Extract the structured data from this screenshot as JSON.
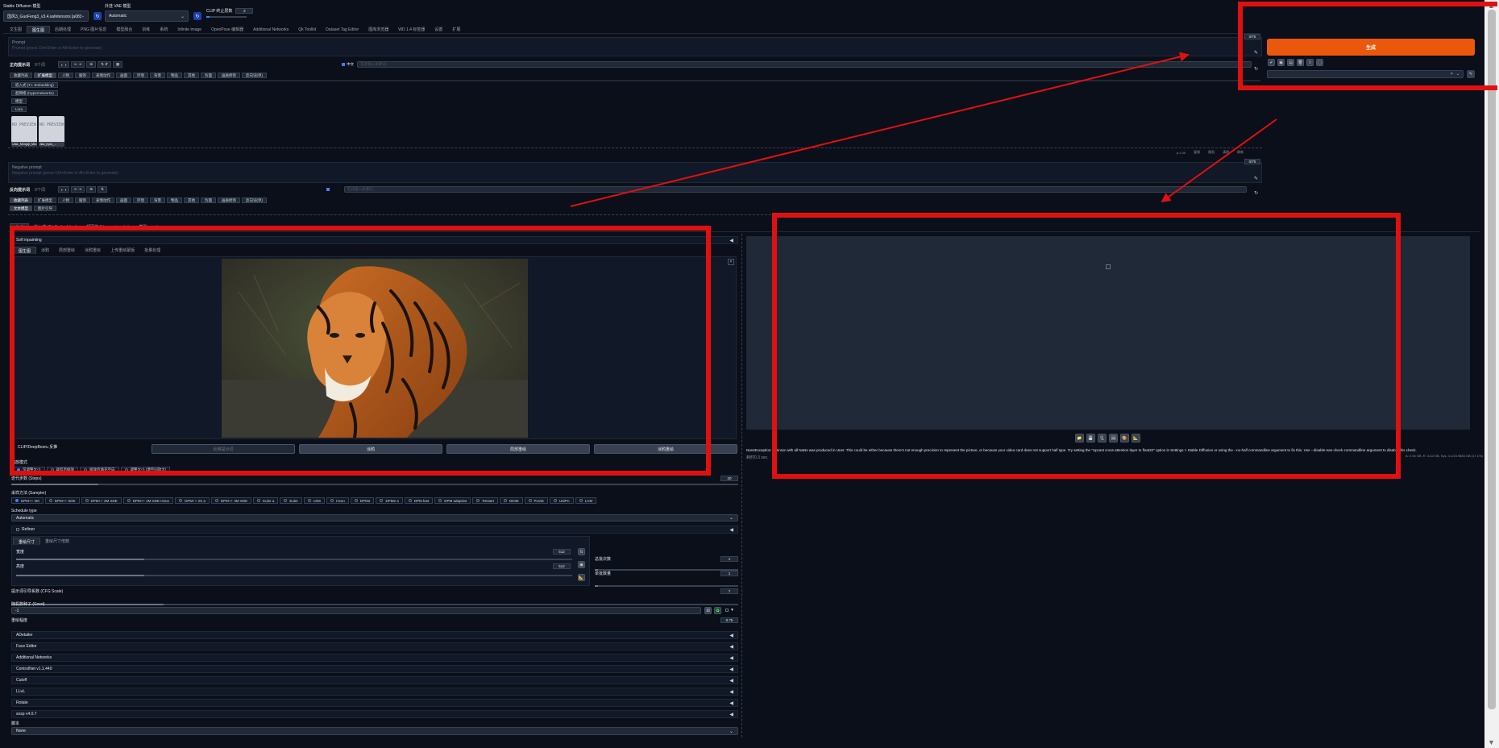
{
  "top": {
    "checkpoint_label": "Stable Diffusion 模型",
    "checkpoint_value": "国风3_GuoFeng3_v3.4.safetensors [a083e8...",
    "vae_label": "外挂 VAE 模型",
    "vae_value": "Automatic",
    "clip_label": "CLIP 终止层数",
    "clip_value": "2"
  },
  "main_tabs": [
    "文生图",
    "图生图",
    "后期处理",
    "PNG 图片信息",
    "模型融合",
    "训练",
    "系统",
    "Infinite image",
    "OpenPose 编辑器",
    "Additional Networks",
    "Qk Toolkit",
    "Dataset Tag Editor",
    "图库浏览器",
    "WD 1.4 标签器",
    "设置",
    "扩展"
  ],
  "prompt": {
    "label": "Prompt",
    "placeholder": "Prompt (press Ctrl+Enter or Alt+Enter to generate)",
    "token_count": "0/75",
    "toolbar_label": "正向提示词",
    "toolbar_count": "0个词",
    "search_placeholder": "在此输入关键词...",
    "lang_badge": "中文"
  },
  "tag_tabs": [
    "收藏列表",
    "扩展模型",
    "人物",
    "服饰",
    "表情动作",
    "画面",
    "环境",
    "背景",
    "物品",
    "其他",
    "负面",
    "画质修饰",
    "反向词(单)"
  ],
  "extra_networks": {
    "buttons": [
      "嵌入式 (T.I. Embedding)",
      "超网络 (Hypernetworks)",
      "模型",
      "Lora"
    ],
    "cards": [
      {
        "thumb": "NO PREVIEW",
        "name": "IJIAL_MengQi_Mec..."
      },
      {
        "thumb": "NO PREVIEW",
        "name": "Jiao_eyes_..."
      }
    ],
    "sort_items": [
      "p:1.00",
      "复制",
      "随机",
      "清除",
      "刷新"
    ]
  },
  "neg_prompt": {
    "label": "Negative prompt",
    "placeholder": "Negative prompt (press Ctrl+Enter or Alt+Enter to generate)",
    "token_count": "0/75",
    "toolbar_label": "反向提示词",
    "toolbar_count": "0个词",
    "search_placeholder": "在此输入关键词..."
  },
  "neg_subtabs": [
    "文本模型",
    "图片引导"
  ],
  "generate": {
    "button": "生成",
    "tool_icons": [
      "✔",
      "▣",
      "▤",
      "🗑",
      "⇧",
      "▢"
    ]
  },
  "settings_tabs": [
    "生成",
    "嵌入式 (T.I. Embedding)",
    "超网络 (Hypernetworks)",
    "模型",
    "Lora"
  ],
  "img2img": {
    "accordion_label": "Soft inpainting",
    "mode_tabs": [
      "图生图",
      "涂鸦",
      "局部重绘",
      "涂鸦重绘",
      "上传重绘蒙版",
      "批量处理"
    ],
    "interrogate_label": "CLIP/DeepBooru 反推",
    "action_buttons": [
      "反推提示词",
      "涂鸦",
      "局部重绘",
      "涂鸦重绘"
    ],
    "resize_label": "缩放模式",
    "resize_modes": [
      "仅调整大小",
      "裁剪后缩放",
      "缩放后填充空白",
      "调整大小 (潜空间放大)"
    ]
  },
  "params": {
    "steps_label": "迭代步数 (Steps)",
    "steps_value": "20",
    "sampler_label": "采样方法 (Sampler)",
    "samplers": [
      "DPM++ 2M",
      "DPM++ SDE",
      "DPM++ 2M SDE",
      "DPM++ 2M SDE Heun",
      "DPM++ 2S a",
      "DPM++ 3M SDE",
      "Euler a",
      "Euler",
      "LMS",
      "Heun",
      "DPM2",
      "DPM2 a",
      "DPM fast",
      "DPM adaptive",
      "Restart",
      "DDIM",
      "PLMS",
      "UniPC",
      "LCM"
    ],
    "schedule_label": "Schedule type",
    "schedule_value": "Automatic",
    "refiner_label": "Refiner",
    "size_tabs": [
      "重绘尺寸",
      "重绘尺寸倍数"
    ],
    "width_label": "宽度",
    "width_value": "512",
    "height_label": "高度",
    "height_value": "512",
    "batch_count_label": "总批次数",
    "batch_count_value": "1",
    "batch_size_label": "单批数量",
    "batch_size_value": "1",
    "cfg_label": "提示词引导系数 (CFG Scale)",
    "cfg_value": "7",
    "seed_label": "随机数种子 (Seed)",
    "seed_value": "-1",
    "denoise_label": "重绘幅度",
    "denoise_value": "0.75"
  },
  "accordions": [
    "ADetailer",
    "Face Editor",
    "Additional Networks",
    "ControlNet v1.1.440",
    "Cutoff",
    "LLuL",
    "Rotate",
    "sosp v4.0.7"
  ],
  "script": {
    "label": "脚本",
    "value": "None"
  },
  "output": {
    "tool_icons": [
      "📁",
      "💾",
      "🗜",
      "🖼",
      "🎨",
      "📐"
    ],
    "error_text": "NansException: A tensor with all NaNs was produced in Unet. This could be either because there's not enough precision to represent the picture, or because your video card does not support half type. Try setting the \"Upcast cross attention layer to float32\" option in Settings > Stable Diffusion or using the --no-half commandline argument to fix this. Use --disable-nan-check commandline argument to disable this check.",
    "time_label": "耗时0.3 sec.",
    "vram_text": "A: 2.94 GB, R: 3.42 GB, Sys: 4.1/23.9883 GB (17.1%)"
  },
  "colors": {
    "accent": "#ea580c",
    "annotation": "#e11010",
    "background": "#0b0f19"
  }
}
